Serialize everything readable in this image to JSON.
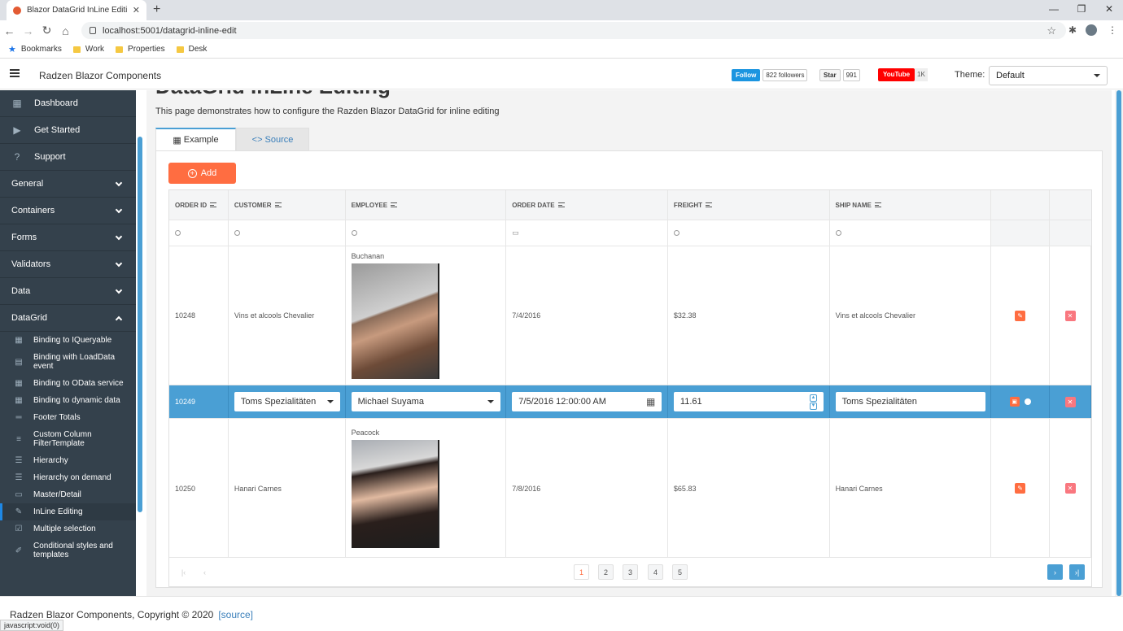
{
  "browser": {
    "tab_title": "Blazor DataGrid InLine Editing",
    "url": "localhost:5001/datagrid-inline-edit",
    "bookmarks": [
      "Bookmarks",
      "Work",
      "Properties",
      "Desk"
    ]
  },
  "header": {
    "brand": "Radzen Blazor Components",
    "twitter_follow": "Follow",
    "twitter_count": "822 followers",
    "github_star": "Star",
    "github_count": "991",
    "youtube": "YouTube",
    "youtube_count": "1K",
    "theme_label": "Theme:",
    "theme_value": "Default"
  },
  "sidebar": {
    "top": [
      {
        "label": "Dashboard",
        "icon": "dashboard-icon"
      },
      {
        "label": "Get Started",
        "icon": "play-icon"
      },
      {
        "label": "Support",
        "icon": "help-icon"
      }
    ],
    "groups": [
      {
        "label": "General",
        "expanded": false
      },
      {
        "label": "Containers",
        "expanded": false
      },
      {
        "label": "Forms",
        "expanded": false
      },
      {
        "label": "Validators",
        "expanded": false
      },
      {
        "label": "Data",
        "expanded": false
      },
      {
        "label": "DataGrid",
        "expanded": true
      }
    ],
    "sub": [
      {
        "label": "Binding to IQueryable",
        "icon": "grid-icon"
      },
      {
        "label": "Binding with LoadData event",
        "icon": "table-icon"
      },
      {
        "label": "Binding to OData service",
        "icon": "dashboard-icon"
      },
      {
        "label": "Binding to dynamic data",
        "icon": "dashboard-icon"
      },
      {
        "label": "Footer Totals",
        "icon": "footer-icon"
      },
      {
        "label": "Custom Column FilterTemplate",
        "icon": "filter-icon"
      },
      {
        "label": "Hierarchy",
        "icon": "list-icon"
      },
      {
        "label": "Hierarchy on demand",
        "icon": "list-icon"
      },
      {
        "label": "Master/Detail",
        "icon": "detail-icon"
      },
      {
        "label": "InLine Editing",
        "icon": "edit-icon",
        "active": true
      },
      {
        "label": "Multiple selection",
        "icon": "checkbox-icon"
      },
      {
        "label": "Conditional styles and templates",
        "icon": "brush-icon"
      }
    ]
  },
  "page": {
    "title": "DataGrid InLine Editing",
    "description": "This page demonstrates how to configure the Razden Blazor DataGrid for inline editing",
    "tabs": [
      "Example",
      "Source"
    ],
    "add_label": "Add"
  },
  "grid": {
    "columns": [
      "ORDER ID",
      "CUSTOMER",
      "EMPLOYEE",
      "ORDER DATE",
      "FREIGHT",
      "SHIP NAME"
    ],
    "rows": [
      {
        "order_id": "10248",
        "customer": "Vins et alcools Chevalier",
        "employee": "Buchanan",
        "order_date": "7/4/2016",
        "freight": "$32.38",
        "ship_name": "Vins et alcools Chevalier"
      },
      {
        "order_id": "10250",
        "customer": "Hanari Carnes",
        "employee": "Peacock",
        "order_date": "7/8/2016",
        "freight": "$65.83",
        "ship_name": "Hanari Carnes"
      }
    ],
    "edit_row": {
      "order_id": "10249",
      "customer": "Toms Spezialitäten",
      "employee": "Michael Suyama",
      "order_date": "7/5/2016 12:00:00 AM",
      "freight": "11.61",
      "ship_name": "Toms Spezialitäten"
    },
    "pages": [
      "1",
      "2",
      "3",
      "4",
      "5"
    ],
    "current_page": "1"
  },
  "footer": {
    "copyright": "Radzen Blazor Components, Copyright © 2020",
    "source_link": "[source]",
    "status_text": "javascript:void(0)"
  },
  "colors": {
    "accent": "#ff6d41",
    "primary": "#4a9fd4",
    "sidebar": "#34414c"
  }
}
